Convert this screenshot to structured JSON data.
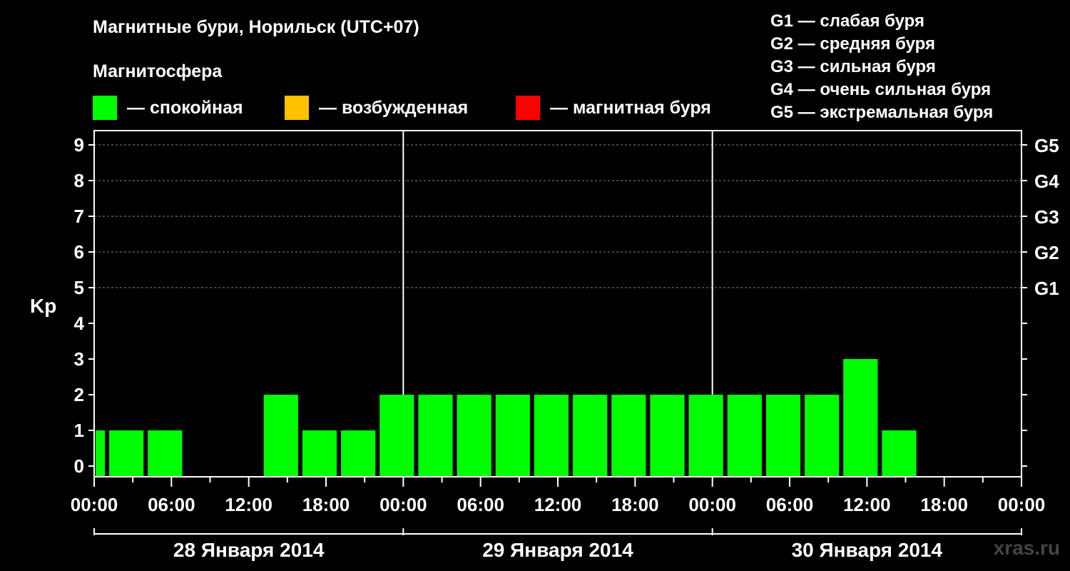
{
  "header": {
    "title": "Магнитные бури, Норильск (UTC+07)",
    "subtitle": "Магнитосфера"
  },
  "legend": [
    {
      "label": "— спокойная",
      "color": "#00ff00"
    },
    {
      "label": "— возбужденная",
      "color": "#ffc000"
    },
    {
      "label": "— магнитная буря",
      "color": "#ff0000"
    }
  ],
  "g_legend": [
    "G1 — слабая буря",
    "G2 — средняя буря",
    "G3 — сильная буря",
    "G4 — очень сильная буря",
    "G5 — экстремальная буря"
  ],
  "watermark": "xras.ru",
  "chart_data": {
    "type": "bar",
    "ylabel": "Kp",
    "ylim": [
      -0.3,
      9.4
    ],
    "y_ticks": [
      0,
      1,
      2,
      3,
      4,
      5,
      6,
      7,
      8,
      9
    ],
    "g_ticks": [
      {
        "y": 5,
        "label": "G1"
      },
      {
        "y": 6,
        "label": "G2"
      },
      {
        "y": 7,
        "label": "G3"
      },
      {
        "y": 8,
        "label": "G4"
      },
      {
        "y": 9,
        "label": "G5"
      }
    ],
    "x_range_hours": [
      0,
      72
    ],
    "x_tick_labels": [
      "00:00",
      "06:00",
      "12:00",
      "18:00",
      "00:00",
      "06:00",
      "12:00",
      "18:00",
      "00:00",
      "06:00",
      "12:00",
      "18:00",
      "00:00"
    ],
    "day_labels": [
      "28 Января 2014",
      "29 Января 2014",
      "30 Января 2014"
    ],
    "bar_color": "#00ff00",
    "bars": [
      {
        "start": 0,
        "end": 1,
        "kp": 1
      },
      {
        "start": 1,
        "end": 4,
        "kp": 1
      },
      {
        "start": 4,
        "end": 7,
        "kp": 1
      },
      {
        "start": 7,
        "end": 10,
        "kp": 0
      },
      {
        "start": 10,
        "end": 13,
        "kp": 0
      },
      {
        "start": 13,
        "end": 16,
        "kp": 2
      },
      {
        "start": 16,
        "end": 19,
        "kp": 1
      },
      {
        "start": 19,
        "end": 22,
        "kp": 1
      },
      {
        "start": 22,
        "end": 25,
        "kp": 2
      },
      {
        "start": 25,
        "end": 28,
        "kp": 2
      },
      {
        "start": 28,
        "end": 31,
        "kp": 2
      },
      {
        "start": 31,
        "end": 34,
        "kp": 2
      },
      {
        "start": 34,
        "end": 37,
        "kp": 2
      },
      {
        "start": 37,
        "end": 40,
        "kp": 2
      },
      {
        "start": 40,
        "end": 43,
        "kp": 2
      },
      {
        "start": 43,
        "end": 46,
        "kp": 2
      },
      {
        "start": 46,
        "end": 49,
        "kp": 2
      },
      {
        "start": 49,
        "end": 52,
        "kp": 2
      },
      {
        "start": 52,
        "end": 55,
        "kp": 2
      },
      {
        "start": 55,
        "end": 58,
        "kp": 2
      },
      {
        "start": 58,
        "end": 61,
        "kp": 3
      },
      {
        "start": 61,
        "end": 64,
        "kp": 1
      }
    ],
    "grid": "dashed at 5-9",
    "day_separators_hours": [
      24,
      48
    ]
  }
}
